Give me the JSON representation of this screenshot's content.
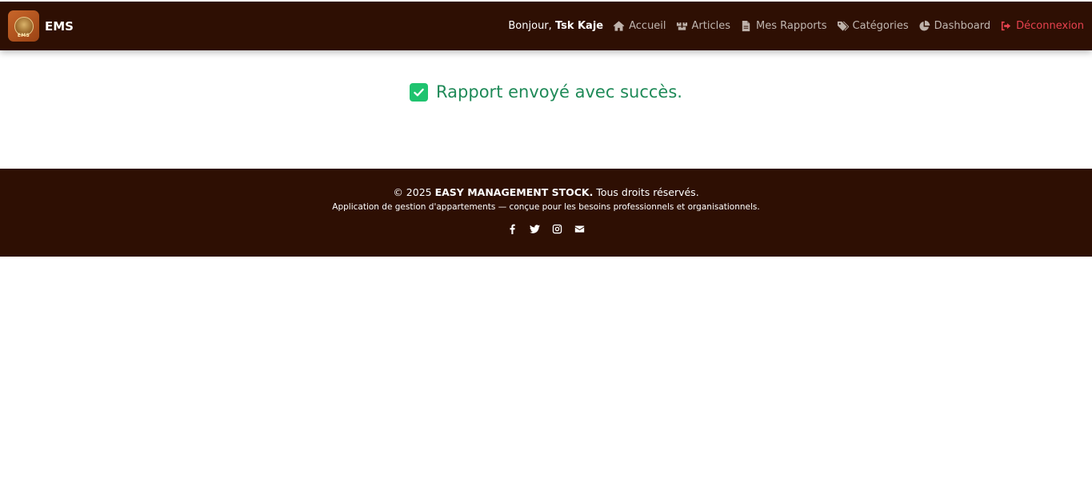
{
  "navbar": {
    "brand": "EMS",
    "logo_text": "EMS",
    "greeting_prefix": "Bonjour,",
    "user_name": "Tsk Kaje",
    "links": [
      {
        "label": "Accueil",
        "icon": "home-icon"
      },
      {
        "label": "Articles",
        "icon": "boxes-icon"
      },
      {
        "label": "Mes Rapports",
        "icon": "file-icon"
      },
      {
        "label": "Catégories",
        "icon": "tags-icon"
      },
      {
        "label": "Dashboard",
        "icon": "pie-chart-icon"
      },
      {
        "label": "Déconnexion",
        "icon": "logout-icon"
      }
    ]
  },
  "main": {
    "success_message": "Rapport envoyé avec succès."
  },
  "footer": {
    "copyright_prefix": "© 2025",
    "company": "EASY MANAGEMENT STOCK.",
    "rights": "Tous droits réservés.",
    "tagline": "Application de gestion d'appartements — conçue pour les besoins professionnels et organisationnels.",
    "socials": [
      "facebook-icon",
      "twitter-icon",
      "instagram-icon",
      "email-icon"
    ]
  },
  "colors": {
    "header_bg": "#2e0f03",
    "success": "#1fc36f",
    "logout": "#e8424f"
  }
}
